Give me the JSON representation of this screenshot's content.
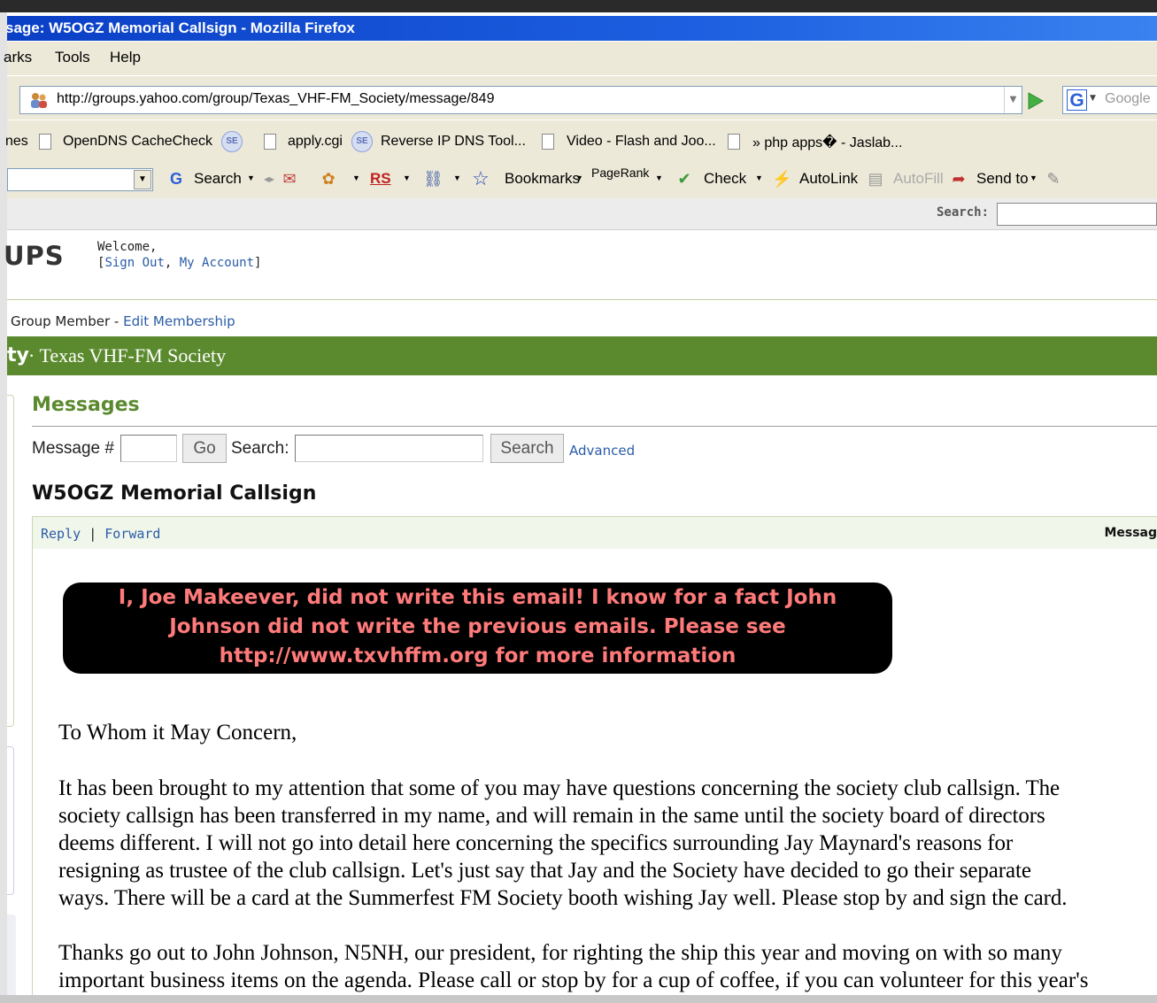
{
  "window": {
    "title": "sage: W5OGZ Memorial Callsign - Mozilla Firefox"
  },
  "menu": {
    "items": [
      {
        "label": "arks"
      },
      {
        "label": "Tools"
      },
      {
        "label": "Help"
      }
    ]
  },
  "nav": {
    "url": "http://groups.yahoo.com/group/Texas_VHF-FM_Society/message/849",
    "search_engine_placeholder": "Google"
  },
  "bookmarks_bar": {
    "items": [
      {
        "label": "nes"
      },
      {
        "label": "OpenDNS CacheCheck"
      },
      {
        "label": "apply.cgi"
      },
      {
        "label": "Reverse IP DNS Tool..."
      },
      {
        "label": "Video - Flash and Joo..."
      },
      {
        "label": "» php apps� - Jaslab..."
      }
    ],
    "se_badge": "SE"
  },
  "toolbar": {
    "search_label": "Search",
    "rs_label": "RS",
    "bookmarks_label": "Bookmarks",
    "pagerank_label": "PageRank",
    "check_label": "Check",
    "autolink_label": "AutoLink",
    "autofill_label": "AutoFill",
    "sendto_label": "Send to"
  },
  "yahoo": {
    "search_label": "Search:",
    "logo_text": "UPS",
    "welcome_line": "Welcome,",
    "sign_out": "Sign Out",
    "my_account": "My Account"
  },
  "group": {
    "membership_status": "Group Member",
    "edit_membership": "Edit Membership",
    "name_fragment": "ty",
    "title": "Texas VHF-FM Society"
  },
  "messages": {
    "heading": "Messages",
    "message_num_label": "Message #",
    "go_button": "Go",
    "search_label": "Search:",
    "search_button": "Search",
    "advanced_link": "Advanced",
    "subject": "W5OGZ Memorial Callsign",
    "reply_link": "Reply",
    "forward_link": "Forward",
    "message_label": "Messag"
  },
  "notice": {
    "lines": [
      "I, Joe Makeever, did not write this email! I know for a fact John",
      "Johnson did not write the previous emails. Please see",
      "http://www.txvhffm.org for more information"
    ]
  },
  "body": {
    "greeting": "To Whom it May Concern,",
    "paragraph1": [
      "It has been brought to my attention that some of you may have questions concerning the society club callsign. The",
      "society callsign has been transferred in my name, and will remain in the same until the society board of directors",
      "deems different. I will not go into detail here concerning the specifics surrounding Jay Maynard's reasons for",
      "resigning as trustee of the club callsign. Let's just say that Jay and the Society have decided to go their separate",
      "ways. There will be a card at the Summerfest FM Society booth wishing Jay well. Please stop by and sign the card."
    ],
    "paragraph2": [
      "Thanks go out to John Johnson, N5NH, our president, for righting the ship this year and moving on with so many",
      "important business items on the agenda. Please call or stop by for a cup of coffee, if you can volunteer for this year's"
    ]
  },
  "colors": {
    "title_bar": "#1d5fe0",
    "chrome": "#ece9d8",
    "group_bar": "#5b8a2e",
    "link": "#2a5ca8",
    "notice_text": "#ff7a7a"
  }
}
